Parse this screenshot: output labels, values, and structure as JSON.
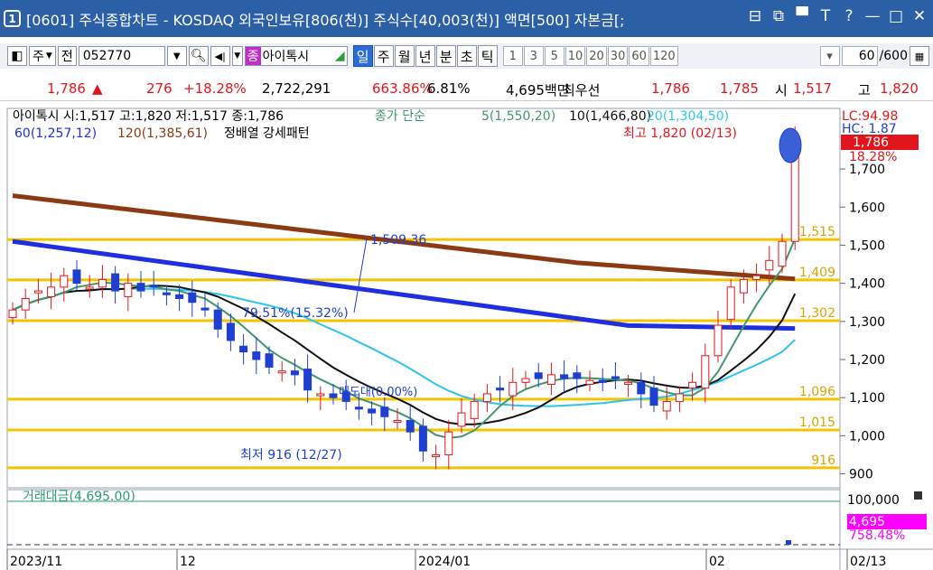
{
  "window": {
    "badge": "1",
    "title": "[0601] 주식종합차트 - KOSDAQ 외국인보유[806(천)] 주식수[40,003(천)] 액면[500] 자본금[;",
    "icons": [
      "restore-icon",
      "popup-icon",
      "pin-icon",
      "font-icon",
      "help-icon",
      "minimize-icon",
      "maximize-icon",
      "close-icon"
    ],
    "icon_glyphs": [
      "⊟",
      "⧉",
      "▀",
      "T",
      "?",
      "—",
      "□",
      "✕"
    ]
  },
  "toolbar": {
    "period_mode": "주",
    "view_mode": "전",
    "stock_code": "052770",
    "stock_badge": "종",
    "stock_name": "아이톡시",
    "periods": [
      "일",
      "주",
      "월",
      "년",
      "분",
      "초",
      "틱"
    ],
    "active_period": "일",
    "minute_options": [
      "1",
      "3",
      "5",
      "10",
      "20",
      "30",
      "60",
      "120"
    ],
    "zoom": "60",
    "zoom_total": "/600"
  },
  "info": {
    "price": "1,786",
    "arrow": "▲",
    "change": "276",
    "change_pct": "+18.28%",
    "volume": "2,722,291",
    "volume_pct": "663.86%",
    "turnover": "6.81%",
    "amount": "4,695백만",
    "best_label": "최우선",
    "ask": "1,786",
    "bid": "1,785",
    "open_label": "시",
    "open": "1,517",
    "high_label": "고",
    "high": "1,820"
  },
  "legend": {
    "ohlc": "아이톡시 시:1,517 고:1,820 저:1,517 종:1,786",
    "ma_label": "종가 단순",
    "ma5": "5(1,550,20)",
    "ma10": "10(1,466,80)",
    "ma20": "20(1,304,50)",
    "ma60": "60(1,257,12)",
    "ma120": "120(1,385,61)",
    "pattern": "정배열 강세패턴",
    "volume_panel": "거래대금(4,695.00)"
  },
  "annotations": {
    "high": "최고 1,820 (02/13)",
    "low": "최저 916 (12/27)",
    "trend_price": "1,509.36",
    "trend_rate": "79.51%(15.32%)",
    "fib_note": "매도대(0.00%)",
    "lc": "LC:94.98",
    "hc": "HC: 1.87",
    "current": "1,786",
    "current_pct": "18.28%",
    "vol_current": "4,695",
    "vol_pct": "758.48%"
  },
  "colors": {
    "up": "#e1161c",
    "down": "#1f3fd1",
    "ma5": "#41966a",
    "ma10": "#111111",
    "ma20": "#2ec3ee",
    "ma60": "#1f2ee0",
    "ma120": "#8b3a14",
    "hline": "#f2c500",
    "volume_line": "#2a9d6a",
    "title_bar": "#2b5fa6"
  },
  "chart_data": {
    "type": "candlestick",
    "y_ticks": [
      "1,700",
      "1,600",
      "1,500",
      "1,400",
      "1,300",
      "1,200",
      "1,100",
      "1,000",
      "900"
    ],
    "y_range": [
      880,
      1840
    ],
    "x_labels": [
      "2023/11",
      "12",
      "2024/01",
      "02",
      "02/13"
    ],
    "hlines": [
      {
        "label": "1,515",
        "value": 1515
      },
      {
        "label": "1,409",
        "value": 1409
      },
      {
        "label": "1,302",
        "value": 1302
      },
      {
        "label": "1,096",
        "value": 1096
      },
      {
        "label": "1,015",
        "value": 1015
      },
      {
        "label": "916",
        "value": 916
      }
    ],
    "volume_tick": "100,000"
  }
}
